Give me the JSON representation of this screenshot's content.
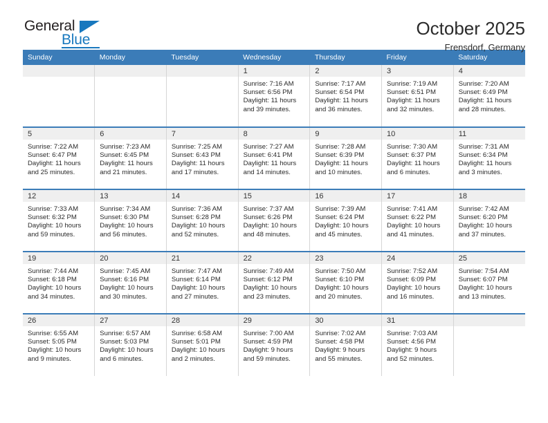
{
  "brand": {
    "name_top": "General",
    "name_bottom": "Blue",
    "accent_color": "#1878be"
  },
  "header": {
    "title": "October 2025",
    "subtitle": "Frensdorf, Germany"
  },
  "calendar": {
    "header_bg": "#3b7cb8",
    "weekday_headers": [
      "Sunday",
      "Monday",
      "Tuesday",
      "Wednesday",
      "Thursday",
      "Friday",
      "Saturday"
    ],
    "labels": {
      "sunrise": "Sunrise:",
      "sunset": "Sunset:",
      "daylight": "Daylight:"
    },
    "weeks": [
      [
        {
          "day": ""
        },
        {
          "day": ""
        },
        {
          "day": ""
        },
        {
          "day": "1",
          "sunrise": "Sunrise: 7:16 AM",
          "sunset": "Sunset: 6:56 PM",
          "daylight_1": "Daylight: 11 hours",
          "daylight_2": "and 39 minutes."
        },
        {
          "day": "2",
          "sunrise": "Sunrise: 7:17 AM",
          "sunset": "Sunset: 6:54 PM",
          "daylight_1": "Daylight: 11 hours",
          "daylight_2": "and 36 minutes."
        },
        {
          "day": "3",
          "sunrise": "Sunrise: 7:19 AM",
          "sunset": "Sunset: 6:51 PM",
          "daylight_1": "Daylight: 11 hours",
          "daylight_2": "and 32 minutes."
        },
        {
          "day": "4",
          "sunrise": "Sunrise: 7:20 AM",
          "sunset": "Sunset: 6:49 PM",
          "daylight_1": "Daylight: 11 hours",
          "daylight_2": "and 28 minutes."
        }
      ],
      [
        {
          "day": "5",
          "sunrise": "Sunrise: 7:22 AM",
          "sunset": "Sunset: 6:47 PM",
          "daylight_1": "Daylight: 11 hours",
          "daylight_2": "and 25 minutes."
        },
        {
          "day": "6",
          "sunrise": "Sunrise: 7:23 AM",
          "sunset": "Sunset: 6:45 PM",
          "daylight_1": "Daylight: 11 hours",
          "daylight_2": "and 21 minutes."
        },
        {
          "day": "7",
          "sunrise": "Sunrise: 7:25 AM",
          "sunset": "Sunset: 6:43 PM",
          "daylight_1": "Daylight: 11 hours",
          "daylight_2": "and 17 minutes."
        },
        {
          "day": "8",
          "sunrise": "Sunrise: 7:27 AM",
          "sunset": "Sunset: 6:41 PM",
          "daylight_1": "Daylight: 11 hours",
          "daylight_2": "and 14 minutes."
        },
        {
          "day": "9",
          "sunrise": "Sunrise: 7:28 AM",
          "sunset": "Sunset: 6:39 PM",
          "daylight_1": "Daylight: 11 hours",
          "daylight_2": "and 10 minutes."
        },
        {
          "day": "10",
          "sunrise": "Sunrise: 7:30 AM",
          "sunset": "Sunset: 6:37 PM",
          "daylight_1": "Daylight: 11 hours",
          "daylight_2": "and 6 minutes."
        },
        {
          "day": "11",
          "sunrise": "Sunrise: 7:31 AM",
          "sunset": "Sunset: 6:34 PM",
          "daylight_1": "Daylight: 11 hours",
          "daylight_2": "and 3 minutes."
        }
      ],
      [
        {
          "day": "12",
          "sunrise": "Sunrise: 7:33 AM",
          "sunset": "Sunset: 6:32 PM",
          "daylight_1": "Daylight: 10 hours",
          "daylight_2": "and 59 minutes."
        },
        {
          "day": "13",
          "sunrise": "Sunrise: 7:34 AM",
          "sunset": "Sunset: 6:30 PM",
          "daylight_1": "Daylight: 10 hours",
          "daylight_2": "and 56 minutes."
        },
        {
          "day": "14",
          "sunrise": "Sunrise: 7:36 AM",
          "sunset": "Sunset: 6:28 PM",
          "daylight_1": "Daylight: 10 hours",
          "daylight_2": "and 52 minutes."
        },
        {
          "day": "15",
          "sunrise": "Sunrise: 7:37 AM",
          "sunset": "Sunset: 6:26 PM",
          "daylight_1": "Daylight: 10 hours",
          "daylight_2": "and 48 minutes."
        },
        {
          "day": "16",
          "sunrise": "Sunrise: 7:39 AM",
          "sunset": "Sunset: 6:24 PM",
          "daylight_1": "Daylight: 10 hours",
          "daylight_2": "and 45 minutes."
        },
        {
          "day": "17",
          "sunrise": "Sunrise: 7:41 AM",
          "sunset": "Sunset: 6:22 PM",
          "daylight_1": "Daylight: 10 hours",
          "daylight_2": "and 41 minutes."
        },
        {
          "day": "18",
          "sunrise": "Sunrise: 7:42 AM",
          "sunset": "Sunset: 6:20 PM",
          "daylight_1": "Daylight: 10 hours",
          "daylight_2": "and 37 minutes."
        }
      ],
      [
        {
          "day": "19",
          "sunrise": "Sunrise: 7:44 AM",
          "sunset": "Sunset: 6:18 PM",
          "daylight_1": "Daylight: 10 hours",
          "daylight_2": "and 34 minutes."
        },
        {
          "day": "20",
          "sunrise": "Sunrise: 7:45 AM",
          "sunset": "Sunset: 6:16 PM",
          "daylight_1": "Daylight: 10 hours",
          "daylight_2": "and 30 minutes."
        },
        {
          "day": "21",
          "sunrise": "Sunrise: 7:47 AM",
          "sunset": "Sunset: 6:14 PM",
          "daylight_1": "Daylight: 10 hours",
          "daylight_2": "and 27 minutes."
        },
        {
          "day": "22",
          "sunrise": "Sunrise: 7:49 AM",
          "sunset": "Sunset: 6:12 PM",
          "daylight_1": "Daylight: 10 hours",
          "daylight_2": "and 23 minutes."
        },
        {
          "day": "23",
          "sunrise": "Sunrise: 7:50 AM",
          "sunset": "Sunset: 6:10 PM",
          "daylight_1": "Daylight: 10 hours",
          "daylight_2": "and 20 minutes."
        },
        {
          "day": "24",
          "sunrise": "Sunrise: 7:52 AM",
          "sunset": "Sunset: 6:09 PM",
          "daylight_1": "Daylight: 10 hours",
          "daylight_2": "and 16 minutes."
        },
        {
          "day": "25",
          "sunrise": "Sunrise: 7:54 AM",
          "sunset": "Sunset: 6:07 PM",
          "daylight_1": "Daylight: 10 hours",
          "daylight_2": "and 13 minutes."
        }
      ],
      [
        {
          "day": "26",
          "sunrise": "Sunrise: 6:55 AM",
          "sunset": "Sunset: 5:05 PM",
          "daylight_1": "Daylight: 10 hours",
          "daylight_2": "and 9 minutes."
        },
        {
          "day": "27",
          "sunrise": "Sunrise: 6:57 AM",
          "sunset": "Sunset: 5:03 PM",
          "daylight_1": "Daylight: 10 hours",
          "daylight_2": "and 6 minutes."
        },
        {
          "day": "28",
          "sunrise": "Sunrise: 6:58 AM",
          "sunset": "Sunset: 5:01 PM",
          "daylight_1": "Daylight: 10 hours",
          "daylight_2": "and 2 minutes."
        },
        {
          "day": "29",
          "sunrise": "Sunrise: 7:00 AM",
          "sunset": "Sunset: 4:59 PM",
          "daylight_1": "Daylight: 9 hours",
          "daylight_2": "and 59 minutes."
        },
        {
          "day": "30",
          "sunrise": "Sunrise: 7:02 AM",
          "sunset": "Sunset: 4:58 PM",
          "daylight_1": "Daylight: 9 hours",
          "daylight_2": "and 55 minutes."
        },
        {
          "day": "31",
          "sunrise": "Sunrise: 7:03 AM",
          "sunset": "Sunset: 4:56 PM",
          "daylight_1": "Daylight: 9 hours",
          "daylight_2": "and 52 minutes."
        },
        {
          "day": ""
        }
      ]
    ]
  }
}
